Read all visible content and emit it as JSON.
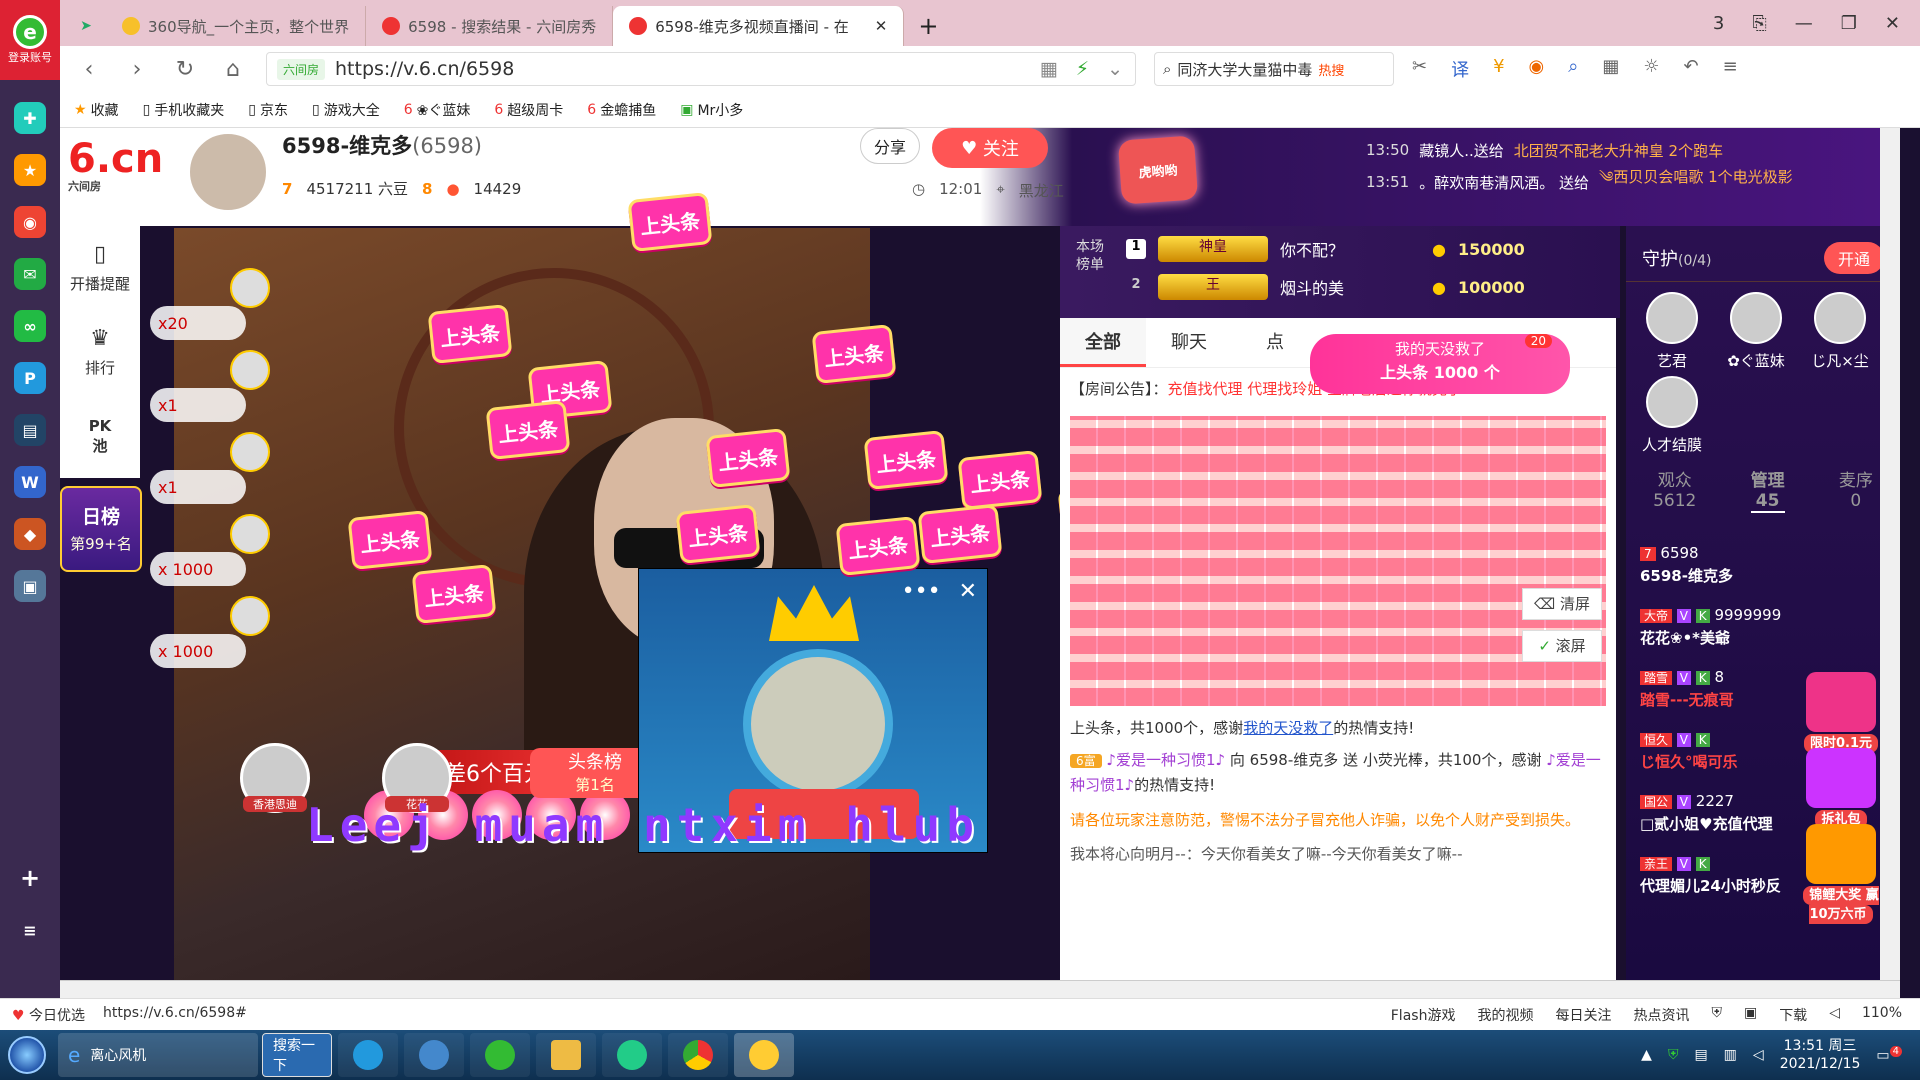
{
  "browser": {
    "account_label": "登录账号",
    "tabs": [
      {
        "label": "360导航_一个主页，整个世界",
        "color": "#f7c02a"
      },
      {
        "label": "6598 - 搜索结果 - 六间房秀",
        "color": "#e33"
      },
      {
        "label": "6598-维克多视频直播间 - 在",
        "color": "#e33"
      }
    ],
    "window_controls": [
      "3",
      "⎘",
      "—",
      "❐",
      "✕"
    ],
    "address": {
      "site_badge": "六间房",
      "url": "https://v.6.cn/6598"
    },
    "search": {
      "text": "同济大学大量猫中毒",
      "hot": "热搜"
    },
    "bookmarks": [
      "收藏",
      "手机收藏夹",
      "京东",
      "游戏大全",
      "❀ぐ蓝妹",
      "超级周卡",
      "金蟾捕鱼",
      "Mr小多"
    ],
    "left_sidebar_icons": [
      "sidebar-app-icon",
      "favorite-star-icon",
      "weibo-icon",
      "mail-icon",
      "sync-icon",
      "pdf-icon",
      "news-icon",
      "doc-icon",
      "game-icon",
      "photo-icon",
      "add-icon",
      "menu-icon"
    ]
  },
  "site": {
    "logo": "6.cn",
    "logo_sub": "六间房",
    "side_nav": [
      {
        "icon": "phone-icon",
        "label": "开播提醒"
      },
      {
        "icon": "crown-icon",
        "label": "排行"
      },
      {
        "icon": "pk-icon",
        "label": "PK\n池"
      }
    ],
    "daily_rank": {
      "title": "日榜",
      "rank": "第99+名"
    }
  },
  "anchor": {
    "name": "6598-维克多",
    "room_id": "(6598)",
    "level_a": "7",
    "beans": "4517211 六豆",
    "level_b": "8",
    "fans": "14429",
    "time": "12:01",
    "location": "黑龙江",
    "share_label": "分享",
    "follow_label": "关注",
    "badge_label": "虎哟哟"
  },
  "ticker": [
    {
      "time": "13:50",
      "text": "藏镜人..送给",
      "gift": "北团贺不配老大升神皇 2个跑车"
    },
    {
      "time": "13:51",
      "text": "。醉欢南巷清风酒。 送给",
      "gift": "༄西贝贝会唱歌 1个电光极影"
    }
  ],
  "video": {
    "gift_list": [
      {
        "count": "x20"
      },
      {
        "count": "x1"
      },
      {
        "count": "x1"
      },
      {
        "count": "x 1000"
      },
      {
        "count": "x 1000"
      }
    ],
    "needs_text": "还差6个百元榜",
    "toutiao_label": "上头条",
    "bottom_gifts": [
      {
        "label": "香港思迪"
      },
      {
        "label": "花花"
      }
    ],
    "rank_badge": {
      "title": "头条榜",
      "rank": "第1名"
    },
    "overlay_text": "Leej muam ntxim hlub",
    "pk_controls": [
      "•••",
      "✕"
    ]
  },
  "rank_panel": {
    "label": "本场榜单",
    "rows": [
      {
        "pos": "1",
        "badge": "神皇",
        "name": "你不配？",
        "coins": "150000"
      },
      {
        "pos": "2",
        "badge": "王",
        "name": "烟斗的美",
        "coins": "100000"
      }
    ]
  },
  "chat": {
    "tabs": [
      "全部",
      "聊天",
      "点"
    ],
    "gift_popup": {
      "line1": "我的天没救了",
      "line2": "上头条 1000 个",
      "count": "20"
    },
    "notice_label": "【房间公告】：",
    "notice_text": "充值找代理 代理找玲姐 金牌老店返你就完了",
    "screen_buttons": [
      "清屏",
      "滚屏"
    ],
    "thanks_msg": {
      "pre": "上头条，共1000个，感谢",
      "user": "我的天没救了",
      "post": "的热情支持!"
    },
    "gift_msg": {
      "tag": "6富",
      "user": "♪爱是一种习惯1♪",
      "to": "向 6598-维克多 送",
      "gift": "小荧光棒，共100个，感谢",
      "user2": "♪爱是一种习惯1♪",
      "post": "的热情支持!"
    },
    "warning": "请各位玩家注意防范，警惕不法分子冒充他人诈骗，以免个人财产受到损失。",
    "last_msg": "我本将心向明月--：今天你看美女了嘛--今天你看美女了嘛--"
  },
  "guard": {
    "title": "守护",
    "count": "(0/4)",
    "open_label": "开通",
    "guardians": [
      "艺君",
      "✿ぐ蓝妹",
      "じ凡×尘",
      "人才结膜"
    ],
    "tabs": [
      {
        "label": "观众",
        "count": "5612"
      },
      {
        "label": "管理",
        "count": "45"
      },
      {
        "label": "麦序",
        "count": "0"
      }
    ],
    "list": [
      {
        "badge": "7",
        "line1": "6598",
        "name": "6598-维克多"
      },
      {
        "badge": "大帝",
        "line1": "9999999",
        "name": "花花❀•*美爺"
      },
      {
        "badge": "踏雪",
        "line1": "8",
        "name": "踏雪---无痕哥"
      },
      {
        "badge": "恒久",
        "line1": "",
        "name": "じ恒久°喝可乐"
      },
      {
        "badge": "国公",
        "line1": "2227",
        "name": "□贰小姐♥充值代理"
      },
      {
        "badge": "亲王",
        "line1": "",
        "name": "代理媚儿24小时秒反"
      }
    ],
    "promos": [
      {
        "label": "限时0.1元"
      },
      {
        "label": "拆礼包"
      },
      {
        "label": "锦鲤大奖 赢10万六币"
      }
    ]
  },
  "statusbar": {
    "left": [
      "今日优选",
      "https://v.6.cn/6598#"
    ],
    "right": [
      "Flash游戏",
      "我的视频",
      "每日关注",
      "热点资讯",
      "下载",
      "110%"
    ]
  },
  "taskbar": {
    "ie_label": "离心风机",
    "search_label": "搜索一下",
    "time": "13:51 周三",
    "date": "2021/12/15",
    "notify": "4"
  }
}
